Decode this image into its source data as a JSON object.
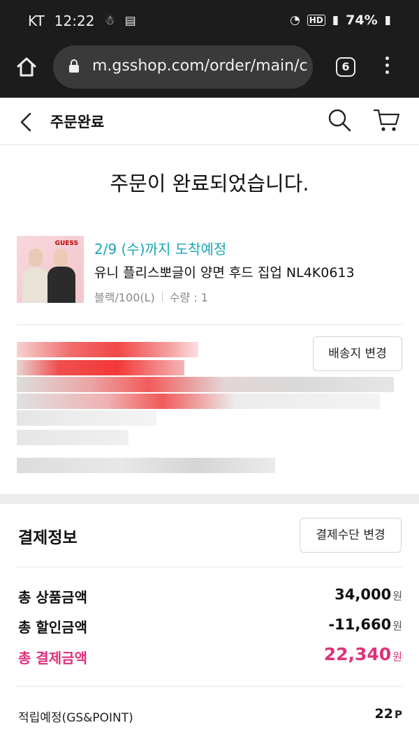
{
  "status_bar": {
    "carrier": "KT",
    "time": "12:22",
    "network": "HD",
    "battery": "74%"
  },
  "browser": {
    "url": "m.gsshop.com/order/main/c",
    "tab_count": "6"
  },
  "header": {
    "title": "주문완료"
  },
  "headline": "주문이 완료되었습니다.",
  "product": {
    "delivery": "2/9 (수)까지 도착예정",
    "name": "유니 플리스뽀글이 양면 후드 집업 NL4K0613",
    "option": "블랙/100(L)",
    "quantity": "수량 : 1",
    "thumb_logo": "GUESS"
  },
  "shipping": {
    "change_button": "배송지 변경"
  },
  "payment": {
    "title": "결제정보",
    "change_button": "결제수단 변경",
    "rows": [
      {
        "label": "총 상품금액",
        "value": "34,000",
        "unit": "원"
      },
      {
        "label": "총 할인금액",
        "value": "-11,660",
        "unit": "원"
      },
      {
        "label": "총 결제금액",
        "value": "22,340",
        "unit": "원"
      }
    ],
    "points_label": "적립예정(GS&POINT)",
    "points_value": "22",
    "points_unit": "P"
  },
  "colors": {
    "accent_teal": "#19a7b5",
    "accent_pink": "#e0317a"
  }
}
